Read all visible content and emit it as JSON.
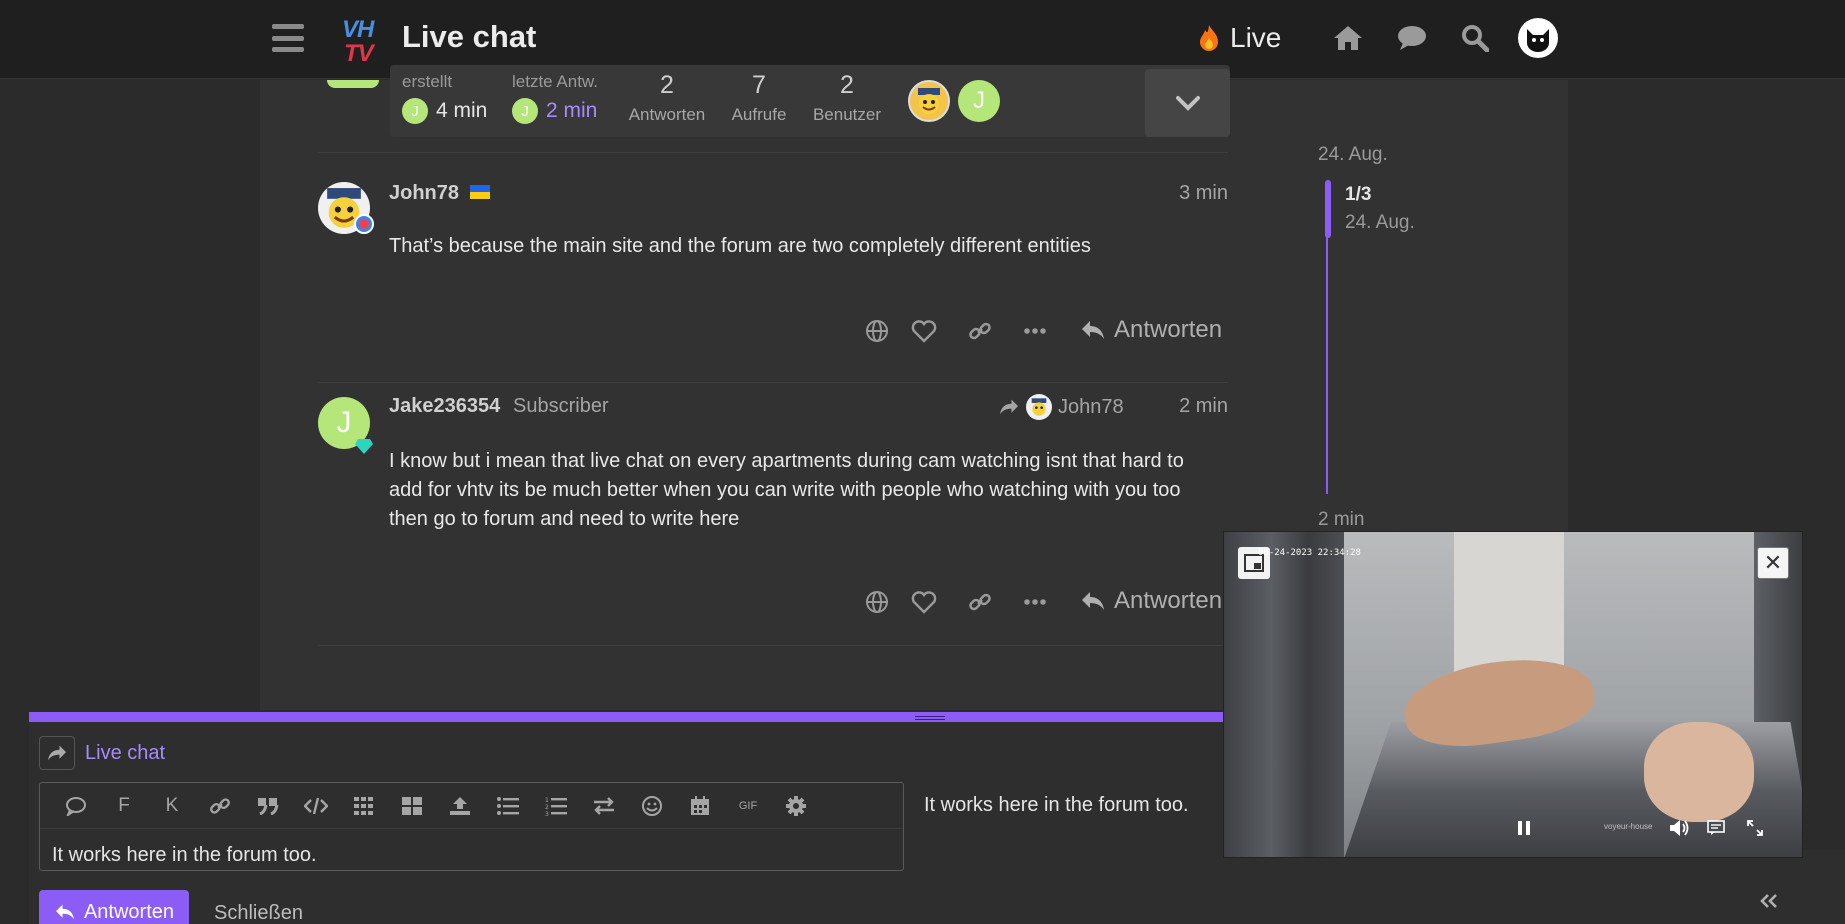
{
  "header": {
    "site_title": "Live chat",
    "logo_top": "VH",
    "logo_bottom": "TV",
    "live_label": "Live"
  },
  "topic_map": {
    "created_label": "erstellt",
    "created_value": "4 min",
    "created_avatar_letter": "J",
    "last_reply_label": "letzte Antw.",
    "last_reply_value": "2 min",
    "last_reply_avatar_letter": "J",
    "stats": [
      {
        "number": "2",
        "caption": "Antworten"
      },
      {
        "number": "7",
        "caption": "Aufrufe"
      },
      {
        "number": "2",
        "caption": "Benutzer"
      }
    ],
    "participant_letter": "J"
  },
  "posts": [
    {
      "username": "John78",
      "time": "3 min",
      "body": "That’s because the main site and the forum are two completely different entities",
      "reply_label": "Antworten"
    },
    {
      "username": "Jake236354",
      "user_title": "Subscriber",
      "avatar_letter": "J",
      "reply_to": "John78",
      "time": "2 min",
      "body": "I know but i mean that live chat on every apartments during cam watching isnt that hard to add for vhtv its be much better when you can write with people who watching with you too then go to forum and need to write here",
      "reply_label": "Antworten"
    }
  ],
  "timeline": {
    "top_date": "24. Aug.",
    "position": "1/3",
    "position_date": "24. Aug.",
    "bottom_date": "2 min"
  },
  "composer": {
    "title": "Live chat",
    "editor_text": "It works here in the forum too.",
    "preview_text": "It works here in the forum too.",
    "toolbar": {
      "bold": "F",
      "italic": "K",
      "gif": "GIF"
    },
    "submit_label": "Antworten",
    "cancel_label": "Schließen"
  },
  "video": {
    "timestamp": "08-24-2023 22:34:28",
    "watermark": "voyeur-house",
    "close_glyph": "✕"
  },
  "colors": {
    "accent": "#8b5cf6",
    "header_bg": "#1f1f1f",
    "content_bg": "#323232",
    "avatar_green": "#b5e67a"
  }
}
